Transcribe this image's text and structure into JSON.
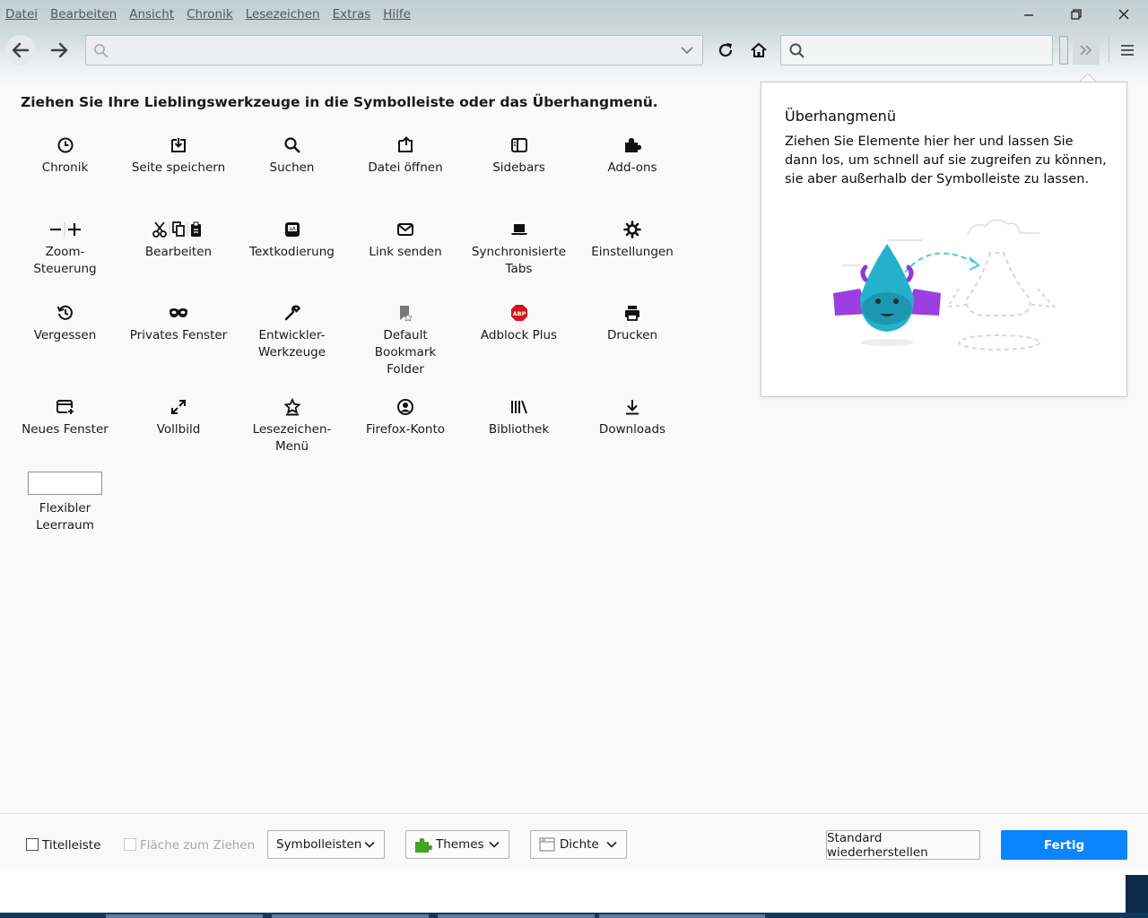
{
  "menubar": {
    "items": [
      "Datei",
      "Bearbeiten",
      "Ansicht",
      "Chronik",
      "Lesezeichen",
      "Extras",
      "Hilfe"
    ]
  },
  "window_controls": [
    "minimize-icon",
    "restore-icon",
    "close-icon"
  ],
  "navbar": {
    "url_value": "",
    "search_value": "",
    "icons": [
      "back-arrow-icon",
      "forward-arrow-icon",
      "reload-icon",
      "home-icon",
      "hamburger-menu-icon",
      "overflow-chevron-icon"
    ]
  },
  "palette": {
    "heading": "Ziehen Sie Ihre Lieblingswerkzeuge in die Symbolleiste oder das Überhangmenü.",
    "items": [
      {
        "label": "Chronik",
        "icon": "clock-icon"
      },
      {
        "label": "Seite speichern",
        "icon": "save-page-icon"
      },
      {
        "label": "Suchen",
        "icon": "search-icon"
      },
      {
        "label": "Datei öffnen",
        "icon": "open-file-icon"
      },
      {
        "label": "Sidebars",
        "icon": "sidebar-icon"
      },
      {
        "label": "Add-ons",
        "icon": "puzzle-icon"
      },
      {
        "label": "Zoom-\nSteuerung",
        "icon": "zoom-icon"
      },
      {
        "label": "Bearbeiten",
        "icon": "cut-copy-paste-icon"
      },
      {
        "label": "Textkodierung",
        "icon": "text-encoding-icon"
      },
      {
        "label": "Link senden",
        "icon": "mail-icon"
      },
      {
        "label": "Synchronisierte\nTabs",
        "icon": "synced-tabs-icon"
      },
      {
        "label": "Einstellungen",
        "icon": "gear-icon"
      },
      {
        "label": "Vergessen",
        "icon": "forget-history-icon"
      },
      {
        "label": "Privates Fenster",
        "icon": "private-mask-icon"
      },
      {
        "label": "Entwickler-\nWerkzeuge",
        "icon": "wrench-icon"
      },
      {
        "label": "Default\nBookmark\nFolder",
        "icon": "bookmark-folder-icon"
      },
      {
        "label": "Adblock Plus",
        "icon": "adblock-icon"
      },
      {
        "label": "Drucken",
        "icon": "printer-icon"
      },
      {
        "label": "Neues Fenster",
        "icon": "new-window-icon"
      },
      {
        "label": "Vollbild",
        "icon": "fullscreen-icon"
      },
      {
        "label": "Lesezeichen-\nMenü",
        "icon": "bookmark-menu-icon"
      },
      {
        "label": "Firefox-Konto",
        "icon": "account-icon"
      },
      {
        "label": "Bibliothek",
        "icon": "library-icon"
      },
      {
        "label": "Downloads",
        "icon": "download-icon"
      },
      {
        "label": "Flexibler\nLeerraum",
        "icon": "flexible-space-box"
      }
    ]
  },
  "overflow_panel": {
    "title": "Überhangmenü",
    "description": "Ziehen Sie Elemente hier her und lassen Sie dann los, um schnell auf sie zugreifen zu können, sie aber außerhalb der Symbolleiste zu lassen."
  },
  "footer": {
    "titlebar_label": "Titelleiste",
    "titlebar_checked": false,
    "dragspace_label": "Fläche zum Ziehen",
    "dragspace_enabled": false,
    "toolbars_label": "Symbolleisten",
    "themes_label": "Themes",
    "density_label": "Dichte",
    "reset_label": "Standard wiederherstellen",
    "done_label": "Fertig"
  },
  "colors": {
    "accent": "#0a84ff",
    "topbar": "#c1d0d4",
    "adblock_red": "#d7141a"
  }
}
